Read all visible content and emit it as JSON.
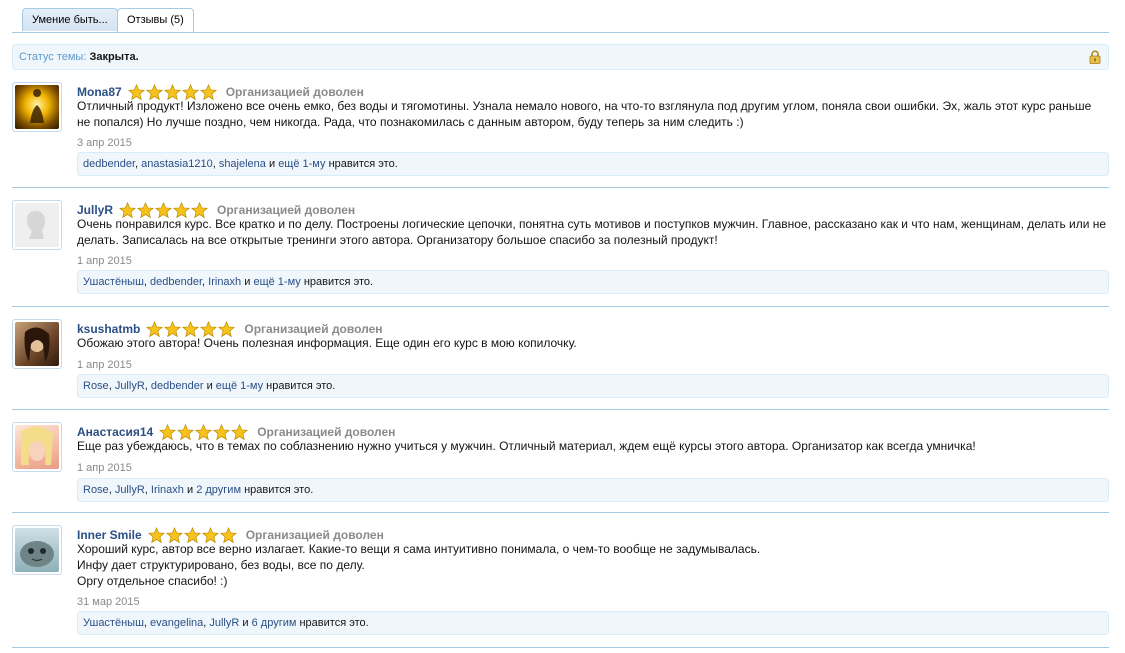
{
  "tabs": [
    {
      "label": "Умение быть...",
      "active": false
    },
    {
      "label": "Отзывы (5)",
      "active": true
    }
  ],
  "status": {
    "label": "Статус темы:",
    "value": "Закрыта.",
    "icon": "lock-icon"
  },
  "colors": {
    "link": "#2b4f86",
    "accent": "#a5cae4",
    "star": "#f7c21b",
    "muted": "#8a8a8a"
  },
  "reviews": [
    {
      "user": "Mona87",
      "rating": 5,
      "verdict": "Организацией доволен",
      "lines": [
        "Отличный продукт! Изложено все очень емко, без воды и тягомотины. Узнала немало нового, на что-то взглянула под другим углом, поняла свои ошибки. Эх, жаль этот курс раньше не попался) Но лучше поздно, чем никогда. Рада, что познакомилась с данным автором, буду теперь за ним следить :)"
      ],
      "date": "3 апр 2015",
      "likes": {
        "users": [
          "dedbender",
          "anastasia1210",
          "shajelena"
        ],
        "and": "и",
        "more": "ещё 1-му",
        "suffix": "нравится это."
      }
    },
    {
      "user": "JullyR",
      "rating": 5,
      "verdict": "Организацией доволен",
      "lines": [
        "Очень понравился курс. Все кратко и по делу. Построены логические цепочки, понятна суть мотивов и поступков мужчин. Главное, рассказано как и что нам, женщинам, делать или не делать. Записалась на все открытые тренинги этого автора. Организатору большое спасибо за полезный продукт!"
      ],
      "date": "1 апр 2015",
      "likes": {
        "users": [
          "Ушастёныш",
          "dedbender",
          "Irinaxh"
        ],
        "and": "и",
        "more": "ещё 1-му",
        "suffix": "нравится это."
      }
    },
    {
      "user": "ksushatmb",
      "rating": 5,
      "verdict": "Организацией доволен",
      "lines": [
        "Обожаю этого автора! Очень полезная информация. Еще один его курс в мою копилочку."
      ],
      "date": "1 апр 2015",
      "likes": {
        "users": [
          "Rose",
          "JullyR",
          "dedbender"
        ],
        "and": "и",
        "more": "ещё 1-му",
        "suffix": "нравится это."
      }
    },
    {
      "user": "Анастасия14",
      "rating": 5,
      "verdict": "Организацией доволен",
      "lines": [
        "Еще раз убеждаюсь, что в темах по соблазнению нужно учиться у мужчин. Отличный материал, ждем ещё курсы этого автора. Организатор как всегда умничка!"
      ],
      "date": "1 апр 2015",
      "likes": {
        "users": [
          "Rose",
          "JullyR",
          "Irinaxh"
        ],
        "and": "и",
        "more": "2 другим",
        "suffix": "нравится это."
      }
    },
    {
      "user": "Inner Smile",
      "rating": 5,
      "verdict": "Организацией доволен",
      "lines": [
        "Хороший курс, автор все верно излагает. Какие-то вещи я сама интуитивно понимала, о чем-то вообще не задумывалась.",
        "Инфу дает структурировано, без воды, все по делу.",
        "Оргу отдельное спасибо! :)"
      ],
      "date": "31 мар 2015",
      "likes": {
        "users": [
          "Ушастёныш",
          "evangelina",
          "JullyR"
        ],
        "and": "и",
        "more": "6 другим",
        "suffix": "нравится это."
      }
    }
  ]
}
